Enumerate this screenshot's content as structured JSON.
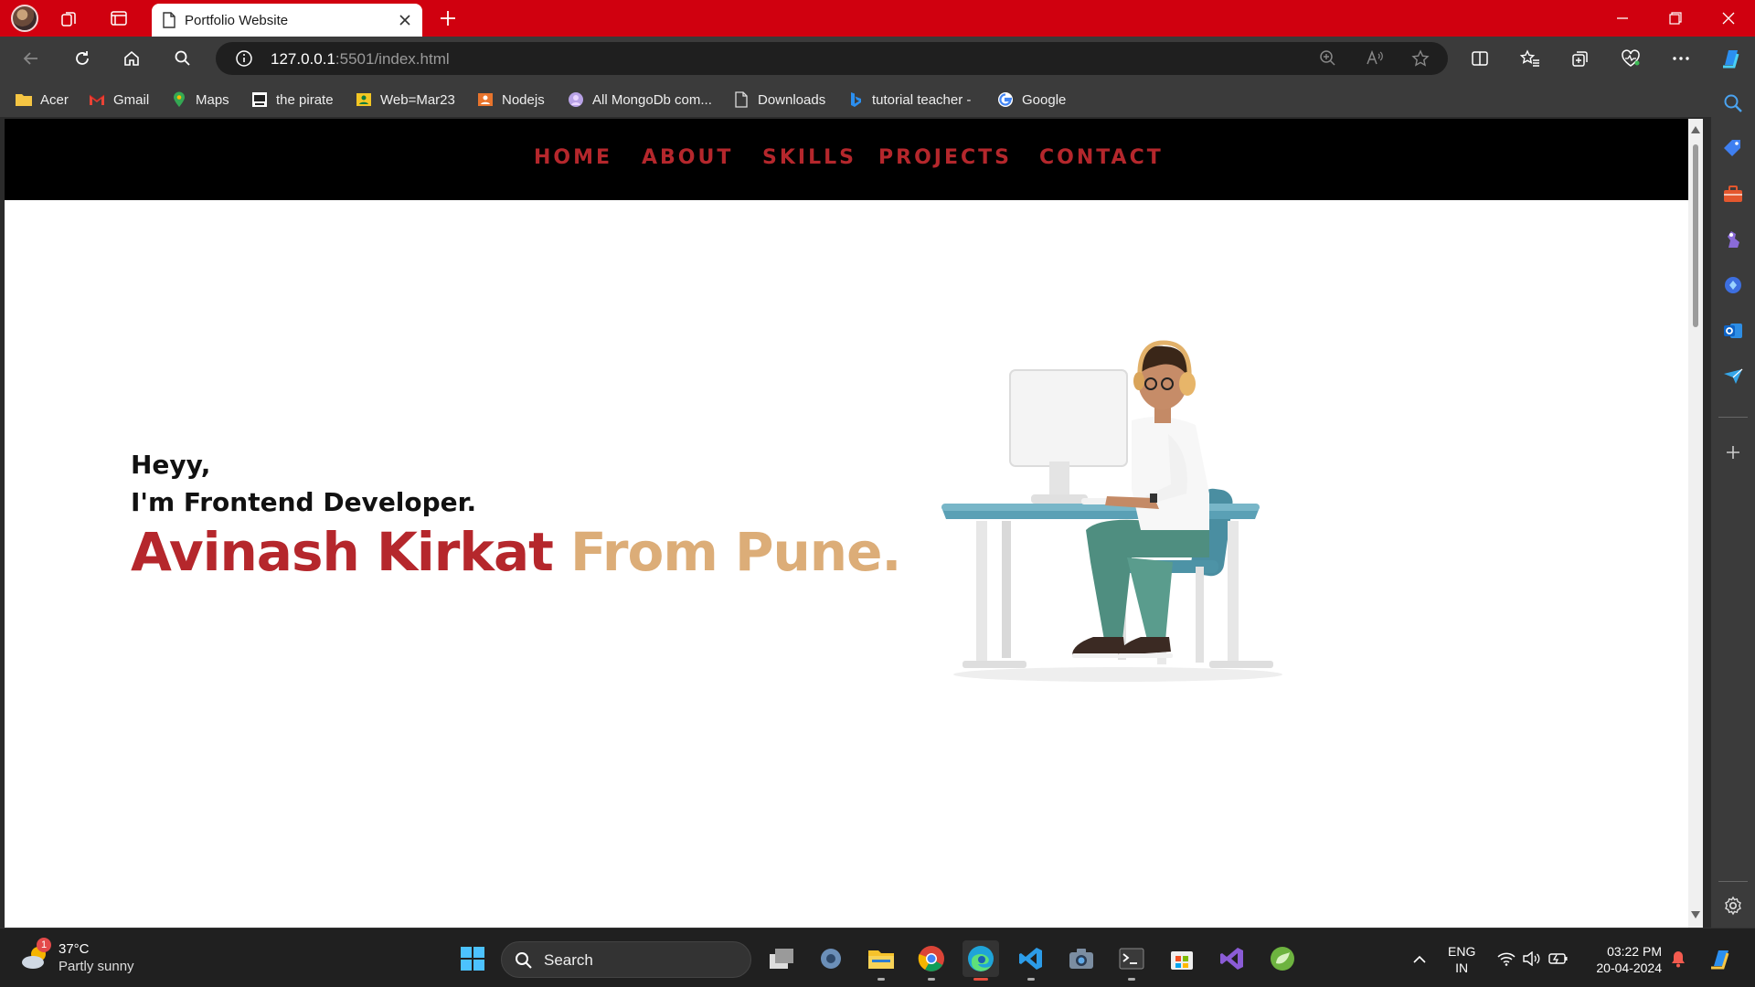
{
  "browser": {
    "tab": {
      "title": "Portfolio Website"
    },
    "address": {
      "host": "127.0.0.1",
      "rest": ":5501/index.html"
    },
    "bookmarks": [
      {
        "label": "Acer",
        "icon": "folder-icon"
      },
      {
        "label": "Gmail",
        "icon": "gmail-icon"
      },
      {
        "label": "Maps",
        "icon": "maps-pin-icon"
      },
      {
        "label": "the pirate",
        "icon": "site-icon"
      },
      {
        "label": "Web=Mar23",
        "icon": "classroom-icon"
      },
      {
        "label": "Nodejs",
        "icon": "classroom-icon"
      },
      {
        "label": "All MongoDb com...",
        "icon": "mongodb-icon"
      },
      {
        "label": "Downloads",
        "icon": "page-icon"
      },
      {
        "label": "tutorial teacher -",
        "icon": "bing-icon"
      },
      {
        "label": "Google",
        "icon": "google-icon"
      }
    ]
  },
  "site": {
    "nav": [
      "HOME",
      "ABOUT",
      "SKILLS",
      "PROJECTS",
      "CONTACT"
    ],
    "hero": {
      "greeting_line1": "Heyy,",
      "greeting_line2": "I'm Frontend Developer.",
      "name": "Avinash Kirkat",
      "from": "From Pune."
    },
    "colors": {
      "accent": "#b5272c",
      "secondary": "#dcad78",
      "nav_bg": "#000000"
    }
  },
  "taskbar": {
    "weather": {
      "temp": "37°C",
      "desc": "Partly sunny",
      "badge": "1"
    },
    "search_label": "Search",
    "lang": {
      "line1": "ENG",
      "line2": "IN"
    },
    "clock": {
      "time": "03:22 PM",
      "date": "20-04-2024"
    }
  },
  "colors": {
    "titlebar": "#d0000f",
    "chrome_bg": "#3b3b3b"
  }
}
